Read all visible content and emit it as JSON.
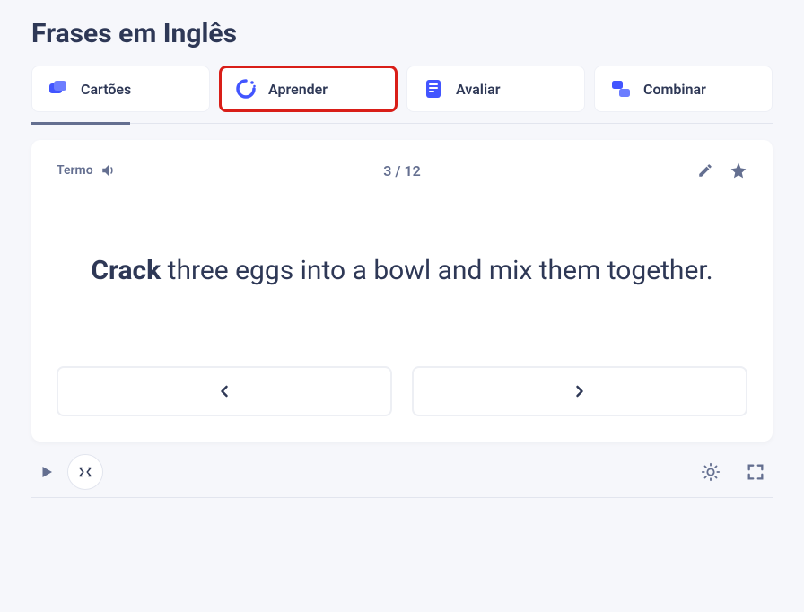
{
  "header": {
    "title": "Frases em Inglês"
  },
  "tabs": [
    {
      "label": "Cartões",
      "icon": "cards"
    },
    {
      "label": "Aprender",
      "icon": "learn"
    },
    {
      "label": "Avaliar",
      "icon": "test"
    },
    {
      "label": "Combinar",
      "icon": "match"
    }
  ],
  "card": {
    "term_label": "Termo",
    "counter": "3 / 12",
    "term_bold": "Crack",
    "term_rest": " three eggs into a bowl and mix them together."
  }
}
